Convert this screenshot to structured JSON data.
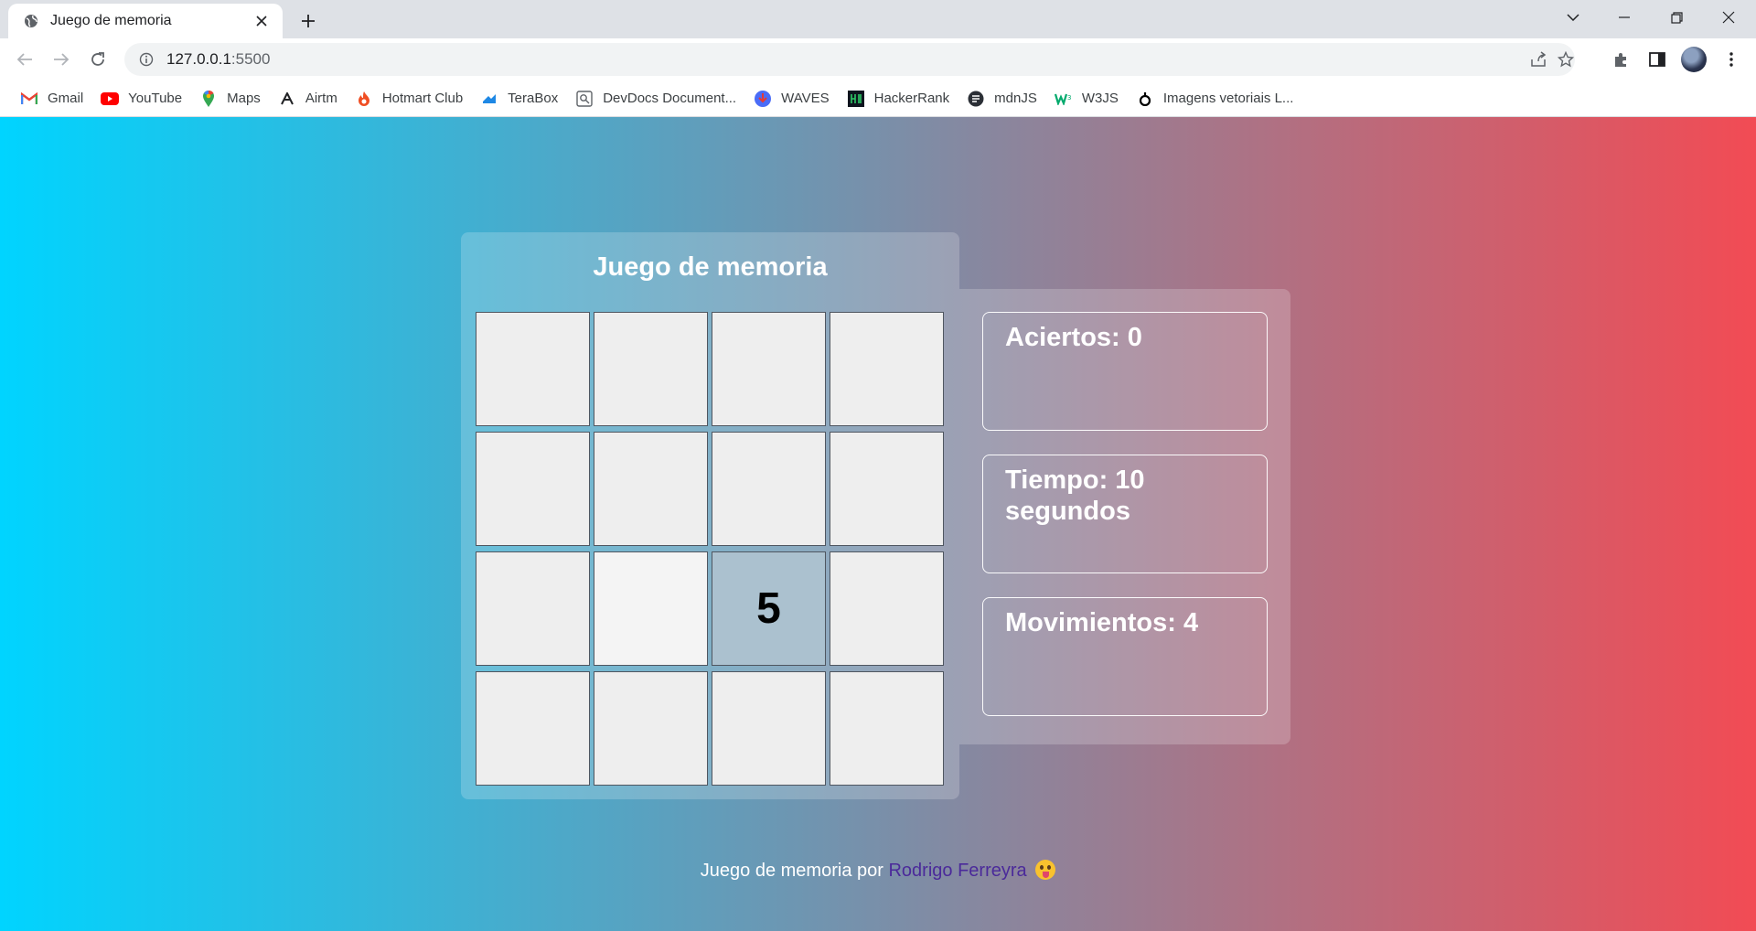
{
  "browser": {
    "tab_title": "Juego de memoria",
    "url_host": "127.0.0.1",
    "url_port": ":5500",
    "bookmarks": [
      {
        "label": "Gmail",
        "icon": "gmail-icon"
      },
      {
        "label": "YouTube",
        "icon": "youtube-icon"
      },
      {
        "label": "Maps",
        "icon": "maps-icon"
      },
      {
        "label": "Airtm",
        "icon": "airtm-icon"
      },
      {
        "label": "Hotmart Club",
        "icon": "hotmart-icon"
      },
      {
        "label": "TeraBox",
        "icon": "terabox-icon"
      },
      {
        "label": "DevDocs Document...",
        "icon": "devdocs-icon"
      },
      {
        "label": "WAVES",
        "icon": "waves-icon"
      },
      {
        "label": "HackerRank",
        "icon": "hackerrank-icon"
      },
      {
        "label": "mdnJS",
        "icon": "mdn-icon"
      },
      {
        "label": "W3JS",
        "icon": "w3js-icon"
      },
      {
        "label": "Imagens vetoriais L...",
        "icon": "imagens-icon"
      }
    ]
  },
  "game": {
    "title": "Juego de memoria",
    "cards": [
      {
        "value": "",
        "state": "hidden"
      },
      {
        "value": "",
        "state": "hidden"
      },
      {
        "value": "",
        "state": "hidden"
      },
      {
        "value": "",
        "state": "hidden"
      },
      {
        "value": "",
        "state": "hidden"
      },
      {
        "value": "",
        "state": "hidden"
      },
      {
        "value": "",
        "state": "hidden"
      },
      {
        "value": "",
        "state": "hidden"
      },
      {
        "value": "",
        "state": "hidden"
      },
      {
        "value": "",
        "state": "hover"
      },
      {
        "value": "5",
        "state": "revealed"
      },
      {
        "value": "",
        "state": "hidden"
      },
      {
        "value": "",
        "state": "hidden"
      },
      {
        "value": "",
        "state": "hidden"
      },
      {
        "value": "",
        "state": "hidden"
      },
      {
        "value": "",
        "state": "hidden"
      }
    ]
  },
  "stats": {
    "aciertos": "Aciertos: 0",
    "tiempo": "Tiempo: 10 segundos",
    "movimientos": "Movimientos: 4"
  },
  "footer": {
    "text": "Juego de memoria por ",
    "author": "Rodrigo Ferreyra"
  }
}
